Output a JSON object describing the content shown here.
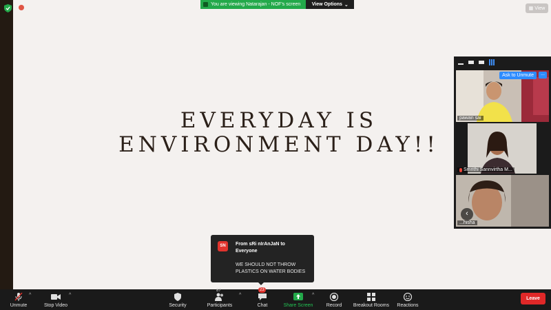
{
  "meeting": {
    "viewing_banner": "You are viewing Natarajan - NOF's screen",
    "view_options_label": "View Options",
    "view_button_label": "View"
  },
  "slide": {
    "title_line1": "EVERYDAY IS",
    "title_line2": "ENVIRONMENT DAY!!"
  },
  "gallery": {
    "ask_to_unmute_label": "Ask to Unmute",
    "more_label": "...",
    "participants": [
      {
        "name": "pawan sai"
      },
      {
        "name": "Smrithi Sannvirtha M..."
      },
      {
        "name": "...hisha"
      }
    ]
  },
  "chat_notification": {
    "avatar_initials": "SN",
    "from": "From sRi nIrAnJaN to Everyone",
    "message": "WE SHOULD NOT THROW PLASTICS ON WATER BODIES"
  },
  "toolbar": {
    "unmute_label": "Unmute",
    "stop_video_label": "Stop Video",
    "security_label": "Security",
    "participants_label": "Participants",
    "participants_count": "87",
    "chat_label": "Chat",
    "chat_badge": "23",
    "share_screen_label": "Share Screen",
    "record_label": "Record",
    "breakout_rooms_label": "Breakout Rooms",
    "reactions_label": "Reactions",
    "leave_label": "Leave"
  },
  "colors": {
    "share_green": "#23a94a",
    "leave_red": "#e02828",
    "accent_blue": "#2d8cff"
  }
}
